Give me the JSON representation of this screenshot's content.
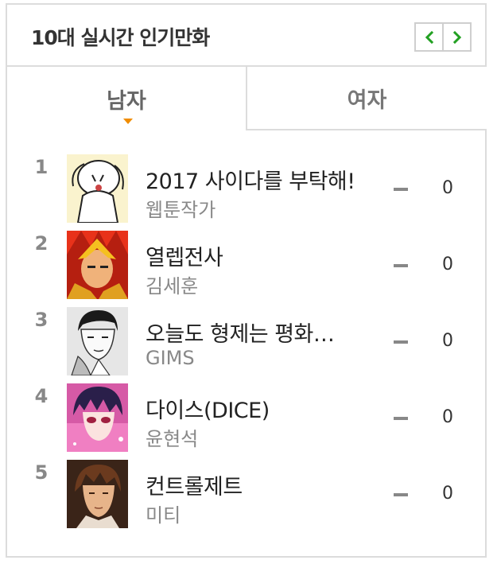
{
  "header": {
    "title": "10대 실시간 인기만화",
    "prev_icon": "chevron-left-icon",
    "next_icon": "chevron-right-icon",
    "accent_color": "#22a022"
  },
  "tabs": [
    {
      "label": "남자",
      "selected": true
    },
    {
      "label": "여자",
      "selected": false
    }
  ],
  "tab_indicator_color": "#f08c00",
  "rankings": [
    {
      "rank": "1",
      "title": "2017 사이다를 부탁해!",
      "author": "웹툰작가",
      "trend": "—",
      "change": "0"
    },
    {
      "rank": "2",
      "title": "열렙전사",
      "author": "김세훈",
      "trend": "—",
      "change": "0"
    },
    {
      "rank": "3",
      "title": "오늘도 형제는 평화…",
      "author": "GIMS",
      "trend": "—",
      "change": "0"
    },
    {
      "rank": "4",
      "title": "다이스(DICE)",
      "author": "윤현석",
      "trend": "—",
      "change": "0"
    },
    {
      "rank": "5",
      "title": "컨트롤제트",
      "author": "미티",
      "trend": "—",
      "change": "0"
    }
  ]
}
